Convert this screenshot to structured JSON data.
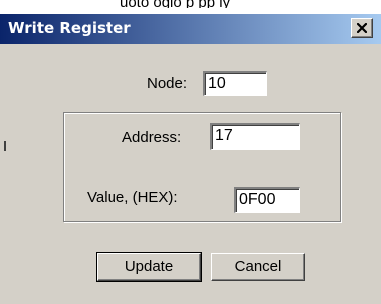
{
  "background_text": "uoto ogio p pp ly",
  "dialog": {
    "title": "Write Register",
    "close_glyph": "✕",
    "fields": {
      "node": {
        "label": "Node:",
        "value": "10"
      },
      "address": {
        "label": "Address:",
        "value": "17"
      },
      "value_hex": {
        "label": "Value, (HEX):",
        "value": "0F00"
      }
    },
    "buttons": {
      "update": "Update",
      "cancel": "Cancel"
    }
  },
  "colors": {
    "title_start": "#0a246a",
    "title_end": "#a6caf0",
    "face": "#d4d0c8"
  }
}
